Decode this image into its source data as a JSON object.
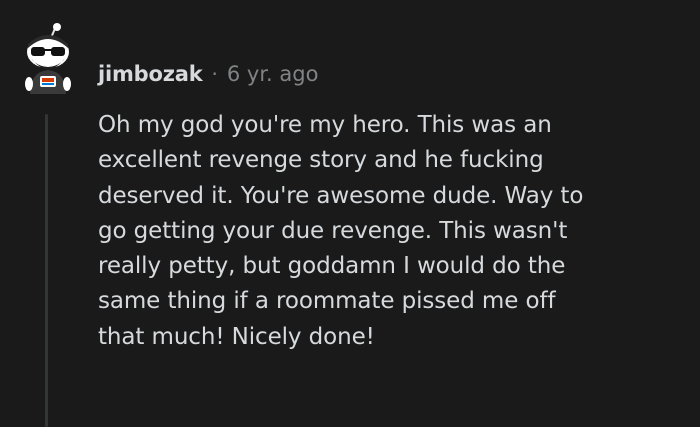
{
  "comment": {
    "author": "jimbozak",
    "separator": "·",
    "timestamp": "6 yr. ago",
    "body": "Oh my god you're my hero. This was an\nexcellent revenge story and he fucking\ndeserved it. You're awesome dude. Way to\ngo getting your due revenge. This wasn't\nreally petty, but goddamn I would do the\nsame thing if a roommate pissed me off\nthat much! Nicely done!",
    "avatar_icon": "snoo-avatar-icon"
  },
  "colors": {
    "background": "#1a1a1b",
    "text": "#d7dadc",
    "muted": "#818384",
    "thread_line": "#343536"
  }
}
